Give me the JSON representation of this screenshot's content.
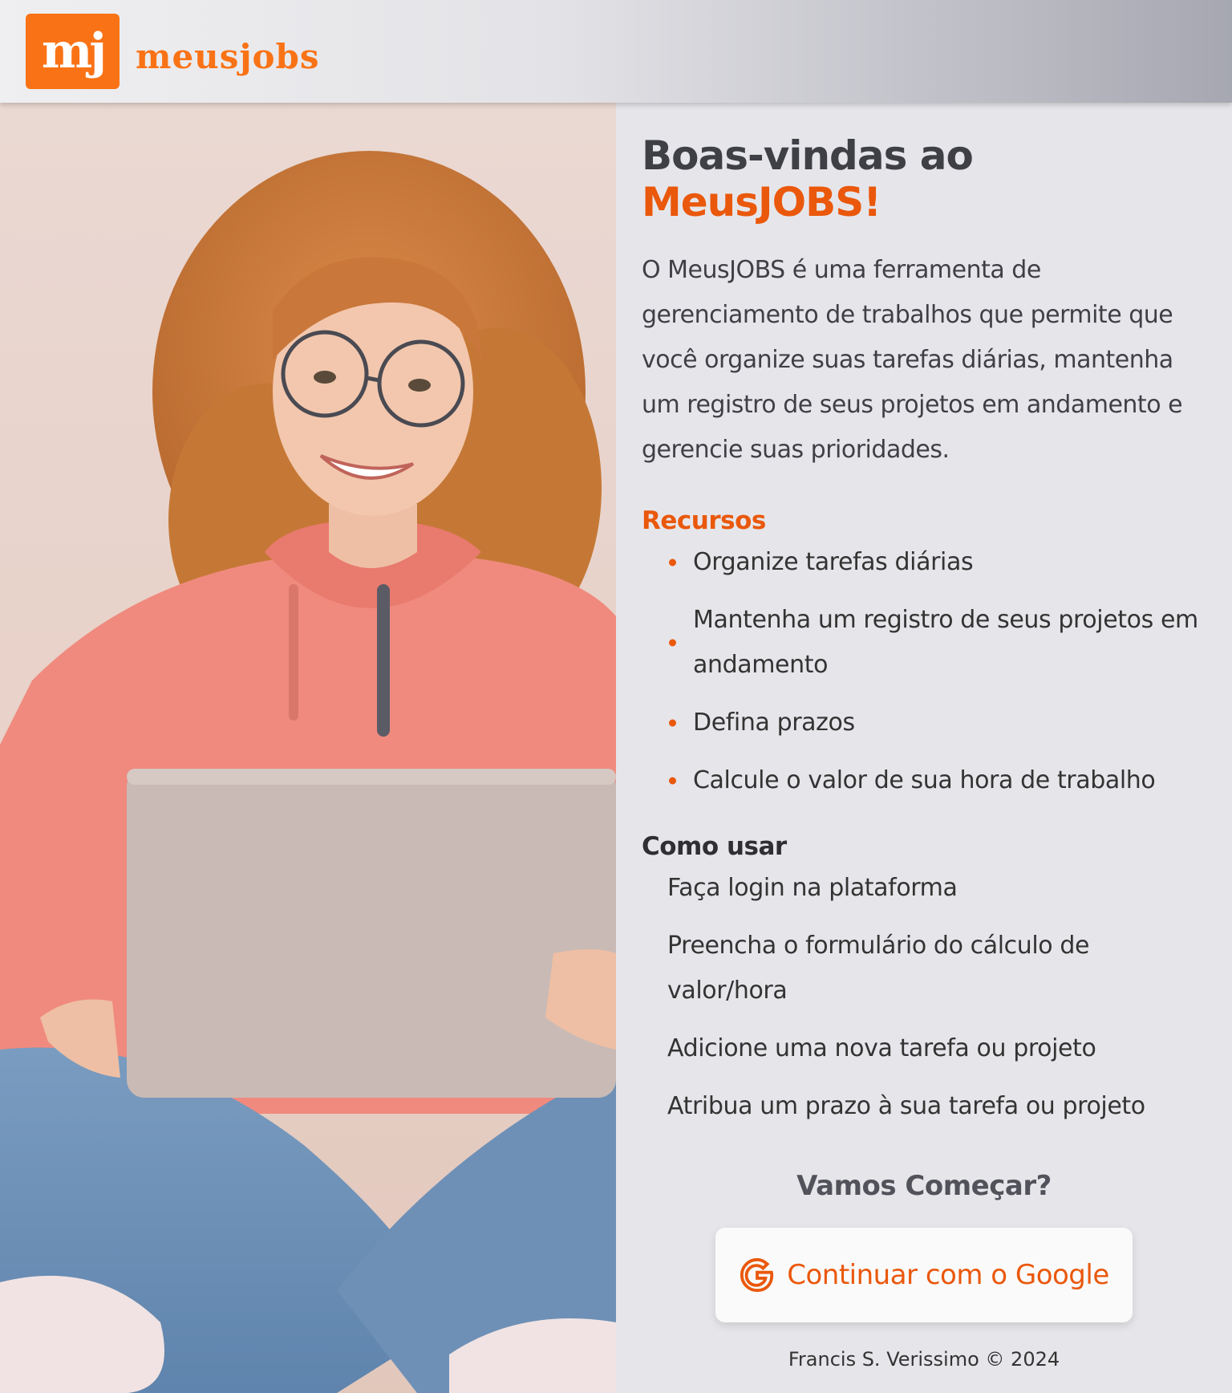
{
  "brand": {
    "logo_mark": "mj",
    "logo_text": "meusjobs",
    "accent_color": "#ea580c"
  },
  "hero": {
    "image": "woman-with-laptop-photo"
  },
  "welcome": {
    "title_prefix": "Boas-vindas ao ",
    "title_brand": "MeusJOBS!",
    "intro": "O MeusJOBS é uma ferramenta de gerenciamento de trabalhos que permite que você organize suas tarefas diárias, mantenha um registro de seus projetos em andamento e gerencie suas prioridades."
  },
  "features": {
    "label": "Recursos",
    "items": [
      "Organize tarefas diárias",
      "Mantenha um registro de seus projetos em andamento",
      "Defina prazos",
      "Calcule o valor de sua hora de trabalho"
    ]
  },
  "howto": {
    "label": "Como usar",
    "items": [
      "Faça login na plataforma",
      "Preencha o formulário do cálculo de valor/hora",
      "Adicione uma nova tarefa ou projeto",
      "Atribua um prazo à sua tarefa ou projeto"
    ]
  },
  "cta": {
    "title": "Vamos Começar?",
    "google_button": "Continuar com o Google",
    "google_icon": "google-g-icon"
  },
  "footer": {
    "text": "Francis S. Verissimo © 2024"
  }
}
